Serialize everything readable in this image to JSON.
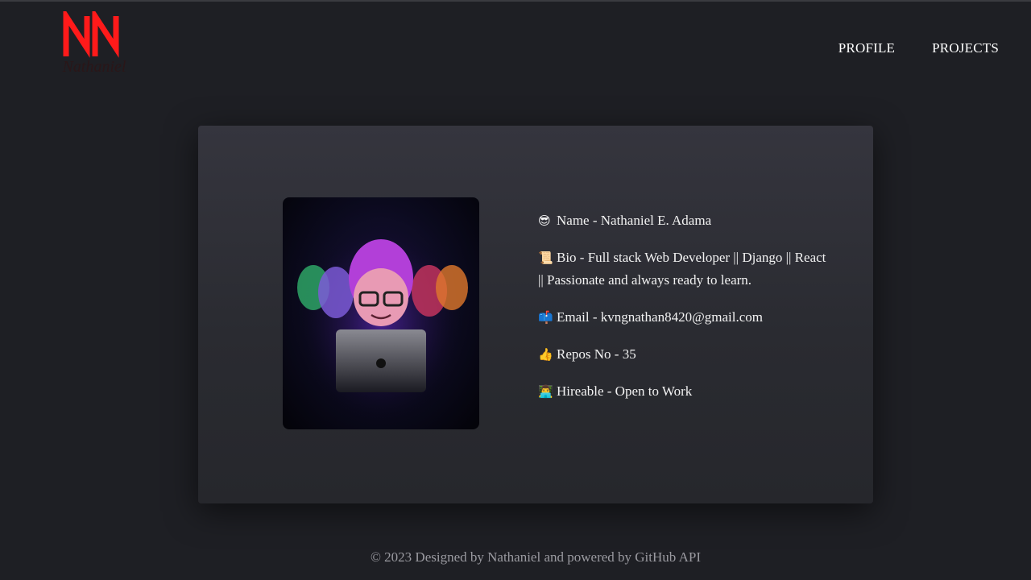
{
  "brand": {
    "logo_text": "Nathaniel",
    "accent_color": "#ff1a1a"
  },
  "nav": {
    "items": [
      {
        "label": "PROFILE"
      },
      {
        "label": "PROJECTS"
      }
    ]
  },
  "profile": {
    "avatar_icon": "memoji-avatar-laptop",
    "fields": [
      {
        "icon": "😎",
        "text": "Name - Nathaniel E. Adama"
      },
      {
        "icon": "📜",
        "text": "Bio - Full stack Web Developer || Django || React || Passionate and always ready to learn."
      },
      {
        "icon": "📫",
        "text": "Email - kvngnathan8420@gmail.com"
      },
      {
        "icon": "👍",
        "text": "Repos No - 35"
      },
      {
        "icon": "👨‍💻",
        "text": "Hireable - Open to Work"
      }
    ]
  },
  "footer": {
    "text": "© 2023 Designed by Nathaniel and powered by GitHub API"
  }
}
